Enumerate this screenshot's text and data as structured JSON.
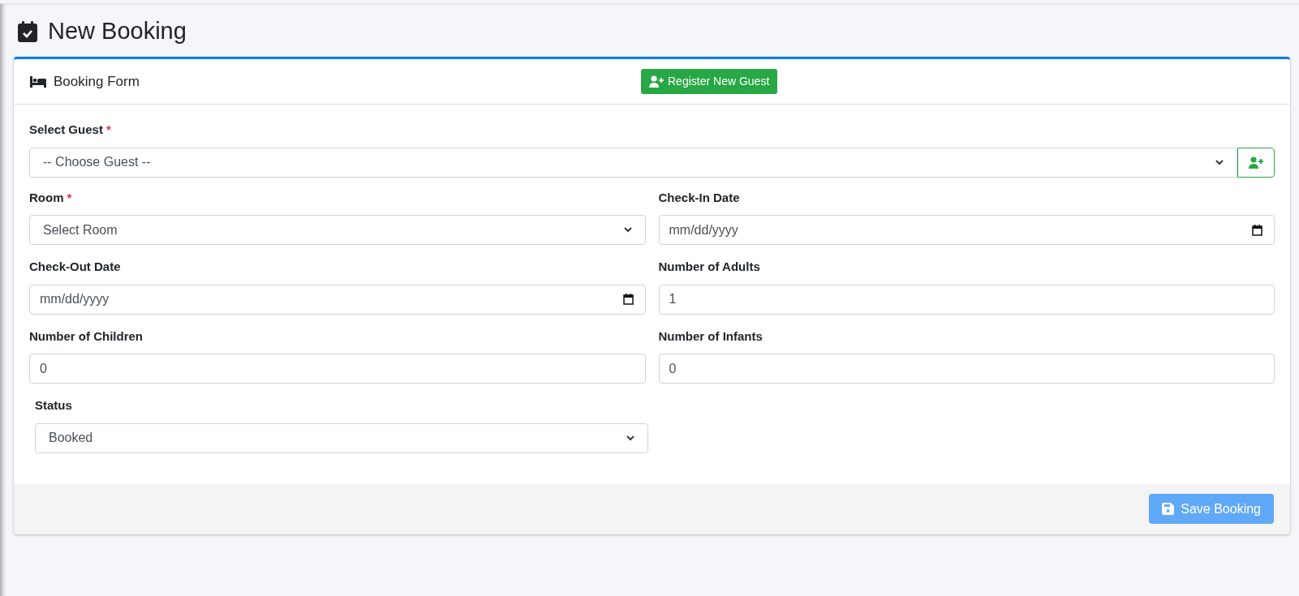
{
  "page_title": "New Booking",
  "card": {
    "title": "Booking Form",
    "header_button": "Register New Guest"
  },
  "guest_field": {
    "label": "Select Guest",
    "required_mark": "*",
    "value": "-- Choose Guest --"
  },
  "fields": [
    {
      "kind": "select",
      "label": "Room",
      "required_mark": "*",
      "value": "Select Room"
    },
    {
      "kind": "date",
      "label": "Check-In Date",
      "value": "mm/dd/yyyy"
    },
    {
      "kind": "date",
      "label": "Check-Out Date",
      "value": "mm/dd/yyyy"
    },
    {
      "kind": "number",
      "label": "Number of Adults",
      "value": "1"
    },
    {
      "kind": "number",
      "label": "Number of Children",
      "value": "0"
    },
    {
      "kind": "number",
      "label": "Number of Infants",
      "value": "0"
    }
  ],
  "status_field": {
    "label": "Status",
    "value": "Booked"
  },
  "save_button": {
    "label": "Save Booking",
    "disabled": true
  }
}
